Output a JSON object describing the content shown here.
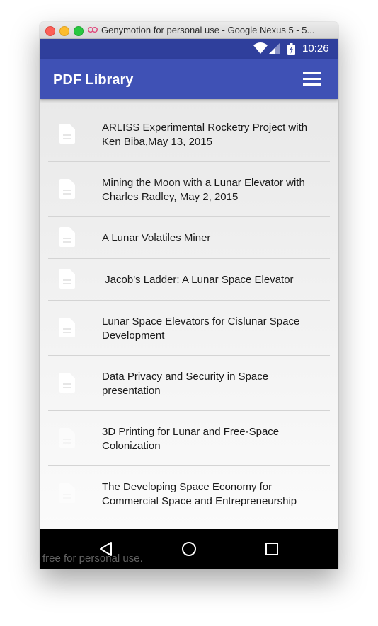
{
  "window": {
    "title": "Genymotion for personal use - Google Nexus 5 - 5..."
  },
  "status_bar": {
    "time": "10:26"
  },
  "app_bar": {
    "title": "PDF Library"
  },
  "documents": [
    {
      "title": "ARLISS Experimental Rocketry Project with Ken Biba,May 13, 2015"
    },
    {
      "title": "Mining the Moon with a Lunar Elevator with Charles Radley, May 2, 2015"
    },
    {
      "title": "A Lunar Volatiles Miner"
    },
    {
      "title": " Jacob's Ladder: A Lunar Space Elevator"
    },
    {
      "title": "Lunar Space Elevators for Cislunar Space Development"
    },
    {
      "title": "Data Privacy and Security in Space presentation"
    },
    {
      "title": "3D Printing for Lunar and Free-Space Colonization"
    },
    {
      "title": "The Developing Space Economy for Commercial Space and Entrepreneurship"
    }
  ],
  "watermark": "free for personal use.",
  "colors": {
    "status_bar": "#2f3f9c",
    "app_bar": "#3f51b5",
    "nav_bar": "#000000"
  }
}
